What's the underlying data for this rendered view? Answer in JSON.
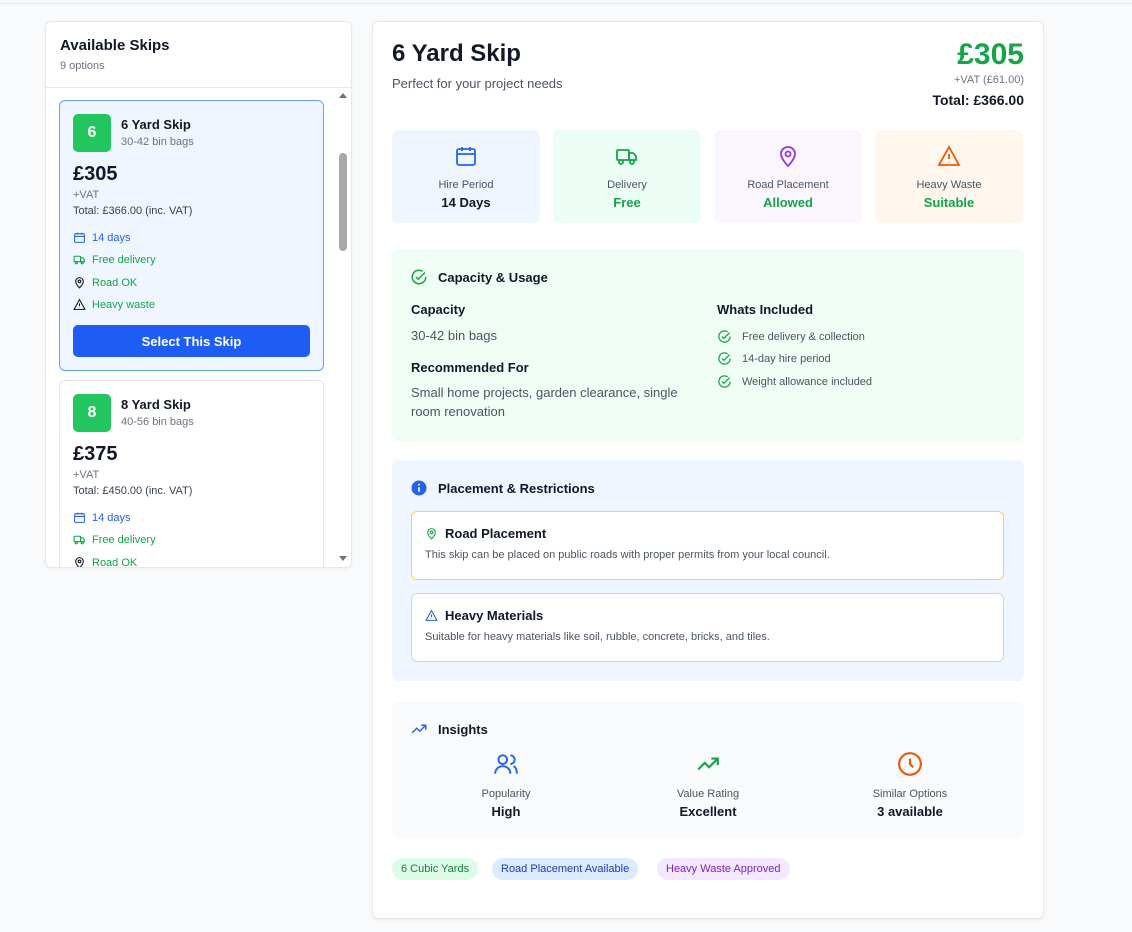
{
  "sidebar": {
    "title": "Available Skips",
    "count": "9 options",
    "cards": [
      {
        "number": "6",
        "name": "6 Yard Skip",
        "bags": "30-42 bin bags",
        "price": "£305",
        "vat": "+VAT",
        "total": "Total: £366.00 (inc. VAT)",
        "features": [
          "14 days",
          "Free delivery",
          "Road OK",
          "Heavy waste"
        ],
        "button": "Select This Skip"
      },
      {
        "number": "8",
        "name": "8 Yard Skip",
        "bags": "40-56 bin bags",
        "price": "£375",
        "vat": "+VAT",
        "total": "Total: £450.00 (inc. VAT)",
        "features": [
          "14 days",
          "Free delivery",
          "Road OK"
        ]
      }
    ]
  },
  "main": {
    "title": "6 Yard Skip",
    "subtitle": "Perfect for your project needs",
    "price": "£305",
    "vat": "+VAT (£61.00)",
    "total": "Total: £366.00",
    "tiles": [
      {
        "label": "Hire Period",
        "value": "14 Days",
        "icon": "calendar-icon"
      },
      {
        "label": "Delivery",
        "value": "Free",
        "icon": "truck-icon"
      },
      {
        "label": "Road Placement",
        "value": "Allowed",
        "icon": "map-pin-icon"
      },
      {
        "label": "Heavy Waste",
        "value": "Suitable",
        "icon": "warning-icon"
      }
    ],
    "capacity": {
      "heading": "Capacity & Usage",
      "capacity_label": "Capacity",
      "capacity_value": "30-42 bin bags",
      "recommended_label": "Recommended For",
      "recommended_value": "Small home projects, garden clearance, single room renovation",
      "included_label": "Whats Included",
      "included": [
        "Free delivery & collection",
        "14-day hire period",
        "Weight allowance included"
      ]
    },
    "placement": {
      "heading": "Placement & Restrictions",
      "road_title": "Road Placement",
      "road_text": "This skip can be placed on public roads with proper permits from your local council.",
      "heavy_title": "Heavy Materials",
      "heavy_text": "Suitable for heavy materials like soil, rubble, concrete, bricks, and tiles."
    },
    "insights": {
      "heading": "Insights",
      "items": [
        {
          "label": "Popularity",
          "value": "High",
          "icon": "users-icon"
        },
        {
          "label": "Value Rating",
          "value": "Excellent",
          "icon": "trending-up-icon"
        },
        {
          "label": "Similar Options",
          "value": "3 available",
          "icon": "clock-icon"
        }
      ]
    },
    "tags": [
      "6 Cubic Yards",
      "Road Placement Available",
      "Heavy Waste Approved"
    ]
  },
  "colors": {
    "primary_button": "#1d5cf5",
    "price_green": "#16a34a",
    "badge_green": "#22c55e"
  }
}
